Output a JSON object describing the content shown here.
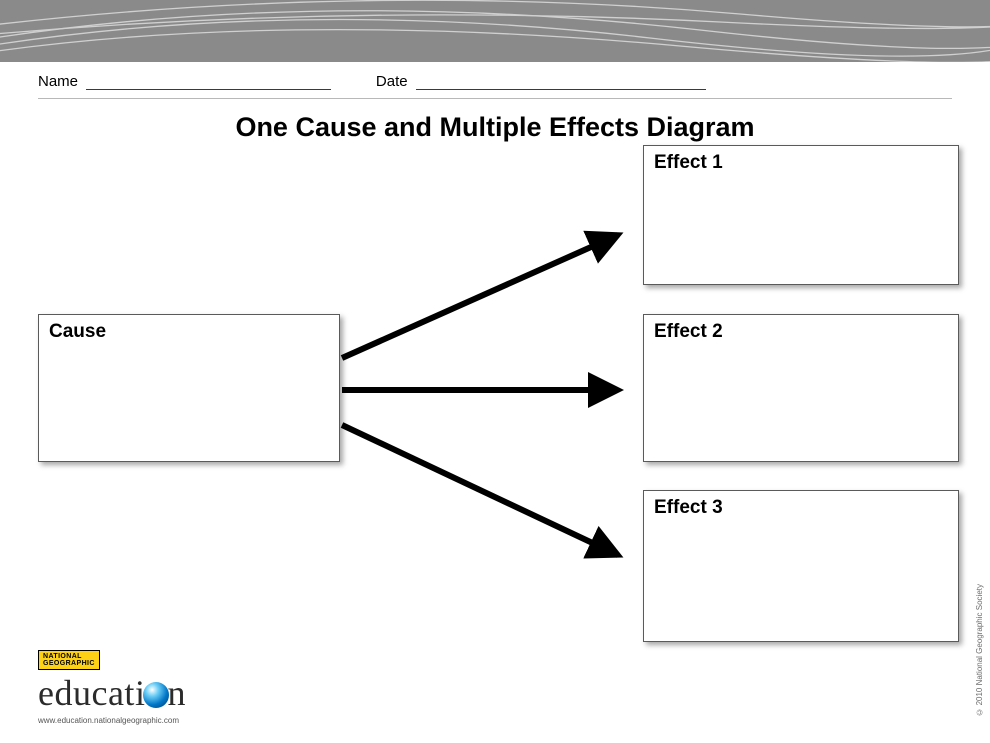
{
  "form": {
    "name_label": "Name",
    "date_label": "Date"
  },
  "title": "One Cause and Multiple Effects Diagram",
  "boxes": {
    "cause_label": "Cause",
    "effect1_label": "Effect 1",
    "effect2_label": "Effect 2",
    "effect3_label": "Effect 3"
  },
  "footer": {
    "badge_line1": "NATIONAL",
    "badge_line2": "GEOGRAPHIC",
    "logo_prefix": "educati",
    "logo_suffix": "n",
    "url": "www.education.nationalgeographic.com"
  },
  "copyright": "© 2010 National Geographic Society"
}
